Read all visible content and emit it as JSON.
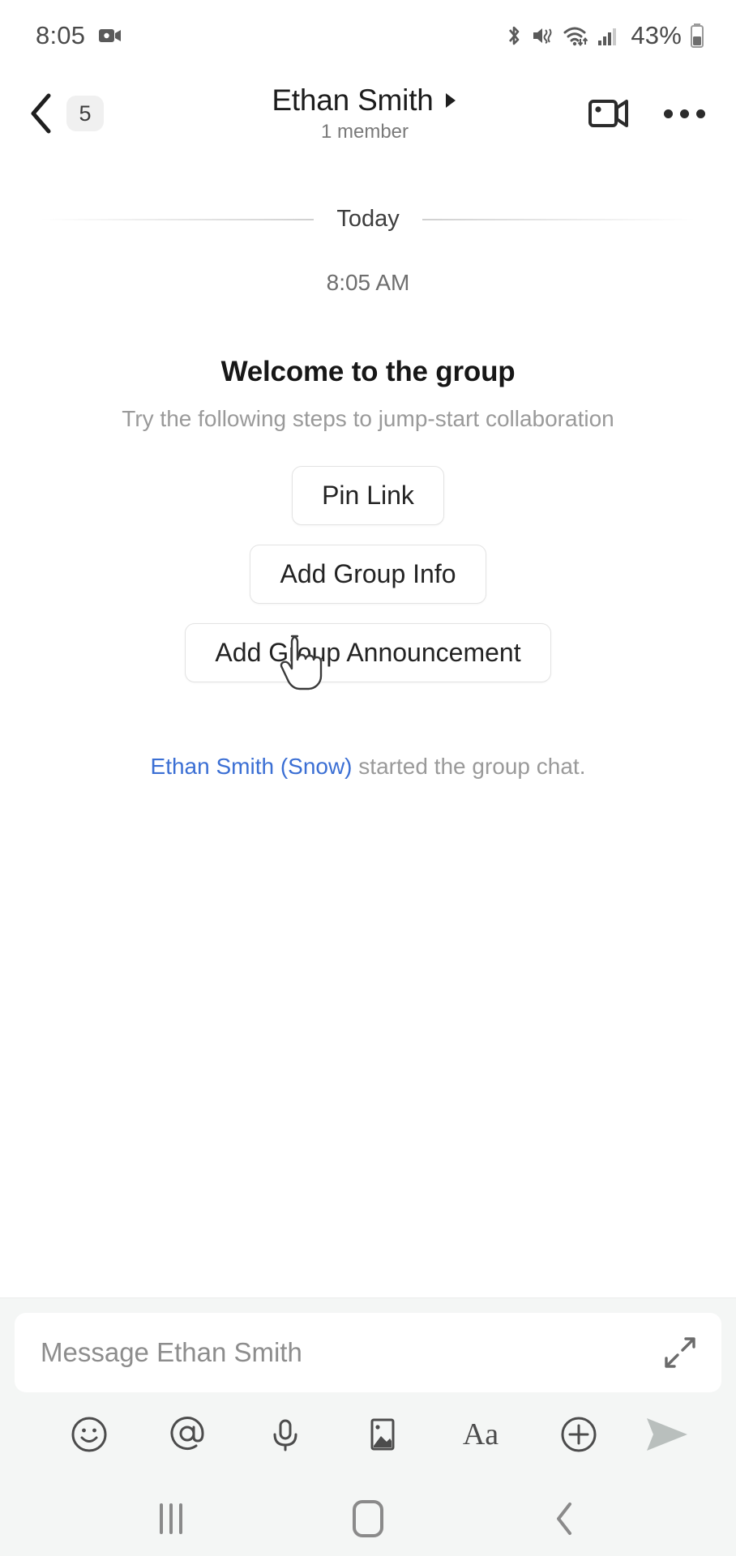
{
  "statusbar": {
    "time": "8:05",
    "recording_icon": "video-recording-icon",
    "bluetooth_icon": "bluetooth-icon",
    "mute_icon": "sound-mute-vibrate-icon",
    "wifi_icon": "wifi-icon",
    "signal_icon": "cellular-signal-icon",
    "battery_percent": "43%",
    "battery_icon": "battery-icon"
  },
  "header": {
    "back_icon": "back-chevron-icon",
    "back_badge": "5",
    "title": "Ethan Smith",
    "title_chevron_icon": "expand-triangle-icon",
    "subtitle": "1 member",
    "video_call_icon": "video-camera-icon",
    "overflow_icon": "more-options-icon"
  },
  "chat": {
    "day_divider": "Today",
    "timestamp": "8:05 AM",
    "welcome_title": "Welcome to the group",
    "welcome_subtitle": "Try the following steps to jump-start collaboration",
    "actions": [
      {
        "label": "Pin Link",
        "name": "pin-link-button"
      },
      {
        "label": "Add Group Info",
        "name": "add-group-info-button"
      },
      {
        "label": "Add Group Announcement",
        "name": "add-group-announcement-button"
      }
    ],
    "system_message": {
      "actor": "Ethan Smith (Snow)",
      "text": " started the group chat.",
      "actor_color": "#3b6fd4"
    },
    "cursor_icon": "pointer-hand-cursor"
  },
  "composer": {
    "placeholder": "Message Ethan Smith",
    "expand_icon": "expand-compose-icon",
    "tools": [
      {
        "name": "emoji-icon",
        "label": "emoji"
      },
      {
        "name": "mention-icon",
        "label": "mention"
      },
      {
        "name": "microphone-icon",
        "label": "voice"
      },
      {
        "name": "image-icon",
        "label": "image"
      },
      {
        "name": "text-format-icon",
        "label": "Aa"
      },
      {
        "name": "add-attachment-icon",
        "label": "more"
      }
    ],
    "send_icon": "send-icon",
    "send_enabled": false
  },
  "navbar": {
    "recents_icon": "recents-icon",
    "home_icon": "home-icon",
    "back_icon": "nav-back-icon"
  },
  "colors": {
    "accent_link": "#3b6fd4",
    "composer_bg": "#f4f6f5",
    "text_primary": "#1c1c1c",
    "text_muted": "#9a9a9a"
  }
}
